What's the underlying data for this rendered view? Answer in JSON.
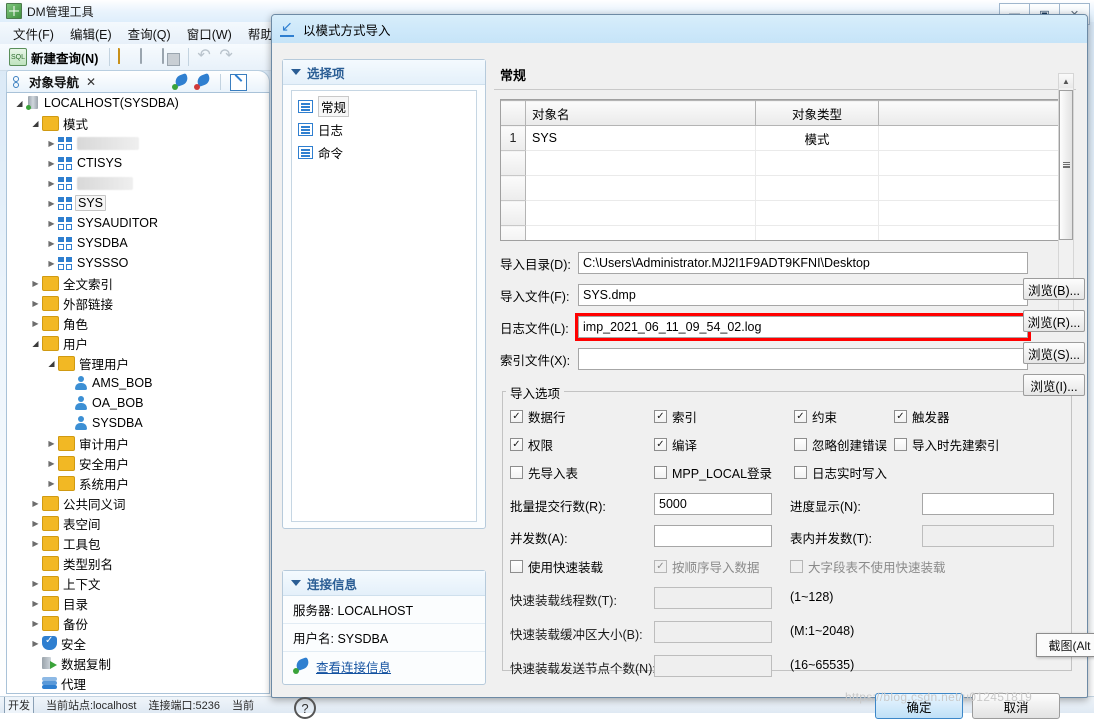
{
  "app": {
    "title": "DM管理工具",
    "window_buttons": {
      "minimize": "—",
      "maximize": "▣",
      "close": "✕"
    },
    "menu": [
      {
        "label": "文件(F)"
      },
      {
        "label": "编辑(E)"
      },
      {
        "label": "查询(Q)"
      },
      {
        "label": "窗口(W)"
      },
      {
        "label": "帮助(H)"
      }
    ],
    "toolbar": {
      "new_query": "新建查询(N)",
      "open_icon": "folder-open-icon",
      "save_icon": "save-icon",
      "save_all_icon": "save-all-icon",
      "undo_icon": "undo-icon",
      "redo_icon": "redo-icon"
    },
    "objnav": {
      "tab_label": "对象导航",
      "tab_close": "✕",
      "connect_icon": "connect-plug-icon",
      "disconnect_icon": "disconnect-plug-icon",
      "edit_icon": "edit-pencil-icon"
    },
    "statusbar": {
      "button": "开发",
      "text1": "当前站点:localhost",
      "text2": "连接端口:5236",
      "text3": "当前"
    }
  },
  "tree": [
    {
      "indent": 0,
      "twisty": "open",
      "icon": "database-icon",
      "label": "LOCALHOST(SYSDBA)"
    },
    {
      "indent": 1,
      "twisty": "open",
      "icon": "folder-icon",
      "label": "模式"
    },
    {
      "indent": 2,
      "twisty": "closed",
      "icon": "schema-icon",
      "label": "",
      "redacted": 62
    },
    {
      "indent": 2,
      "twisty": "closed",
      "icon": "schema-icon",
      "label": "CTISYS"
    },
    {
      "indent": 2,
      "twisty": "closed",
      "icon": "schema-icon",
      "label": "",
      "redacted": 56
    },
    {
      "indent": 2,
      "twisty": "closed",
      "icon": "schema-icon",
      "label": "SYS",
      "selected": true
    },
    {
      "indent": 2,
      "twisty": "closed",
      "icon": "schema-icon",
      "label": "SYSAUDITOR"
    },
    {
      "indent": 2,
      "twisty": "closed",
      "icon": "schema-icon",
      "label": "SYSDBA"
    },
    {
      "indent": 2,
      "twisty": "closed",
      "icon": "schema-icon",
      "label": "SYSSSO"
    },
    {
      "indent": 1,
      "twisty": "closed",
      "icon": "folder-icon",
      "label": "全文索引"
    },
    {
      "indent": 1,
      "twisty": "closed",
      "icon": "folder-icon",
      "label": "外部链接"
    },
    {
      "indent": 1,
      "twisty": "closed",
      "icon": "folder-icon",
      "label": "角色"
    },
    {
      "indent": 1,
      "twisty": "open",
      "icon": "folder-icon",
      "label": "用户"
    },
    {
      "indent": 2,
      "twisty": "open",
      "icon": "folder-icon",
      "label": "管理用户"
    },
    {
      "indent": 3,
      "twisty": "none",
      "icon": "user-icon",
      "label": "AMS_BOB"
    },
    {
      "indent": 3,
      "twisty": "none",
      "icon": "user-icon",
      "label": "OA_BOB"
    },
    {
      "indent": 3,
      "twisty": "none",
      "icon": "user-icon",
      "label": "SYSDBA"
    },
    {
      "indent": 2,
      "twisty": "closed",
      "icon": "folder-icon",
      "label": "审计用户"
    },
    {
      "indent": 2,
      "twisty": "closed",
      "icon": "folder-icon",
      "label": "安全用户"
    },
    {
      "indent": 2,
      "twisty": "closed",
      "icon": "folder-icon",
      "label": "系统用户"
    },
    {
      "indent": 1,
      "twisty": "closed",
      "icon": "folder-icon",
      "label": "公共同义词"
    },
    {
      "indent": 1,
      "twisty": "closed",
      "icon": "folder-icon",
      "label": "表空间"
    },
    {
      "indent": 1,
      "twisty": "closed",
      "icon": "folder-icon",
      "label": "工具包"
    },
    {
      "indent": 1,
      "twisty": "none",
      "icon": "folder-icon",
      "label": "类型别名"
    },
    {
      "indent": 1,
      "twisty": "closed",
      "icon": "folder-icon",
      "label": "上下文"
    },
    {
      "indent": 1,
      "twisty": "closed",
      "icon": "folder-icon",
      "label": "目录"
    },
    {
      "indent": 1,
      "twisty": "closed",
      "icon": "folder-icon",
      "label": "备份"
    },
    {
      "indent": 1,
      "twisty": "closed",
      "icon": "shield-icon",
      "label": "安全"
    },
    {
      "indent": 1,
      "twisty": "none",
      "icon": "replication-icon",
      "label": "数据复制"
    },
    {
      "indent": 1,
      "twisty": "none",
      "icon": "agent-icon",
      "label": "代理"
    }
  ],
  "dialog": {
    "title": "以模式方式导入",
    "icon": "import-icon",
    "left": {
      "options_header": "选择项",
      "options": [
        {
          "label": "常规",
          "selected": true
        },
        {
          "label": "日志",
          "selected": false
        },
        {
          "label": "命令",
          "selected": false
        }
      ],
      "conn_header": "连接信息",
      "server_row": "服务器: LOCALHOST",
      "user_row": "用户名: SYSDBA",
      "view_conn_link": "查看连接信息",
      "conn_link_icon": "connect-plug-icon"
    },
    "section_title": "常规",
    "table": {
      "headers": [
        "",
        "对象名",
        "对象类型",
        ""
      ],
      "rows": [
        {
          "idx": "1",
          "name": "SYS",
          "type": "模式"
        },
        {
          "idx": "",
          "name": "",
          "type": ""
        },
        {
          "idx": "",
          "name": "",
          "type": ""
        },
        {
          "idx": "",
          "name": "",
          "type": ""
        },
        {
          "idx": "",
          "name": "",
          "type": ""
        }
      ]
    },
    "paths": [
      {
        "label": "导入目录(D):",
        "value": "C:\\Users\\Administrator.MJ2I1F9ADT9KFNI\\Desktop",
        "button": "浏览(B)...",
        "highlight": false
      },
      {
        "label": "导入文件(F):",
        "value": "SYS.dmp",
        "button": "浏览(R)...",
        "highlight": false
      },
      {
        "label": "日志文件(L):",
        "value": "imp_2021_06_11_09_54_02.log",
        "button": "浏览(S)...",
        "highlight": true
      },
      {
        "label": "索引文件(X):",
        "value": "",
        "button": "浏览(I)...",
        "highlight": false
      }
    ],
    "import_options": {
      "legend": "导入选项",
      "checkboxes": [
        {
          "label": "数据行",
          "checked": true,
          "disabled": false,
          "col": 0,
          "row": 0
        },
        {
          "label": "索引",
          "checked": true,
          "disabled": false,
          "col": 1,
          "row": 0
        },
        {
          "label": "约束",
          "checked": true,
          "disabled": false,
          "col": 2,
          "row": 0
        },
        {
          "label": "触发器",
          "checked": true,
          "disabled": false,
          "col": 3,
          "row": 0
        },
        {
          "label": "权限",
          "checked": true,
          "disabled": false,
          "col": 0,
          "row": 1
        },
        {
          "label": "编译",
          "checked": true,
          "disabled": false,
          "col": 1,
          "row": 1
        },
        {
          "label": "忽略创建错误",
          "checked": false,
          "disabled": false,
          "col": 2,
          "row": 1
        },
        {
          "label": "导入时先建索引",
          "checked": false,
          "disabled": false,
          "col": 3,
          "row": 1
        },
        {
          "label": "先导入表",
          "checked": false,
          "disabled": false,
          "col": 0,
          "row": 2
        },
        {
          "label": "MPP_LOCAL登录",
          "checked": false,
          "disabled": false,
          "col": 1,
          "row": 2
        },
        {
          "label": "日志实时写入",
          "checked": false,
          "disabled": false,
          "col": 2,
          "row": 2
        }
      ],
      "fields": [
        {
          "label": "批量提交行数(R):",
          "value": "5000",
          "disabled": false,
          "side": "left",
          "row": 0
        },
        {
          "label": "进度显示(N):",
          "value": "",
          "disabled": false,
          "side": "right",
          "row": 0
        },
        {
          "label": "并发数(A):",
          "value": "",
          "disabled": false,
          "side": "left",
          "row": 1
        },
        {
          "label": "表内并发数(T):",
          "value": "",
          "disabled": true,
          "side": "right",
          "row": 1
        }
      ],
      "fastload_checkboxes": [
        {
          "label": "使用快速装载",
          "checked": false,
          "disabled": false
        },
        {
          "label": "按顺序导入数据",
          "checked": true,
          "disabled": true
        },
        {
          "label": "大字段表不使用快速装载",
          "checked": false,
          "disabled": true
        }
      ],
      "fastload_fields": [
        {
          "label": "快速装载线程数(T):",
          "value": "",
          "hint": "(1~128)",
          "disabled": true
        },
        {
          "label": "快速装载缓冲区大小(B):",
          "value": "",
          "hint": "(M:1~2048)",
          "disabled": true
        },
        {
          "label": "快速装载发送节点个数(N):",
          "value": "",
          "hint": "(16~65535)",
          "disabled": true
        }
      ],
      "scrollbar": {
        "up": "▲",
        "down": "▼"
      }
    },
    "tooltip": "截图(Alt + A)",
    "footer": {
      "help_icon": "help-question-icon",
      "ok": "确定",
      "cancel": "取消"
    },
    "window_buttons": {
      "minimize": "—",
      "maximize": "▣",
      "close": "✕"
    }
  },
  "watermark": {
    "line1": "https://blog.csdn.net/u012451819",
    "line2": "https://blog.csdn.net/u012451819"
  },
  "colors": {
    "accent": "#2f7fd0",
    "highlight": "#ff0000",
    "link": "#1452a0",
    "folder": "#f2b823"
  }
}
